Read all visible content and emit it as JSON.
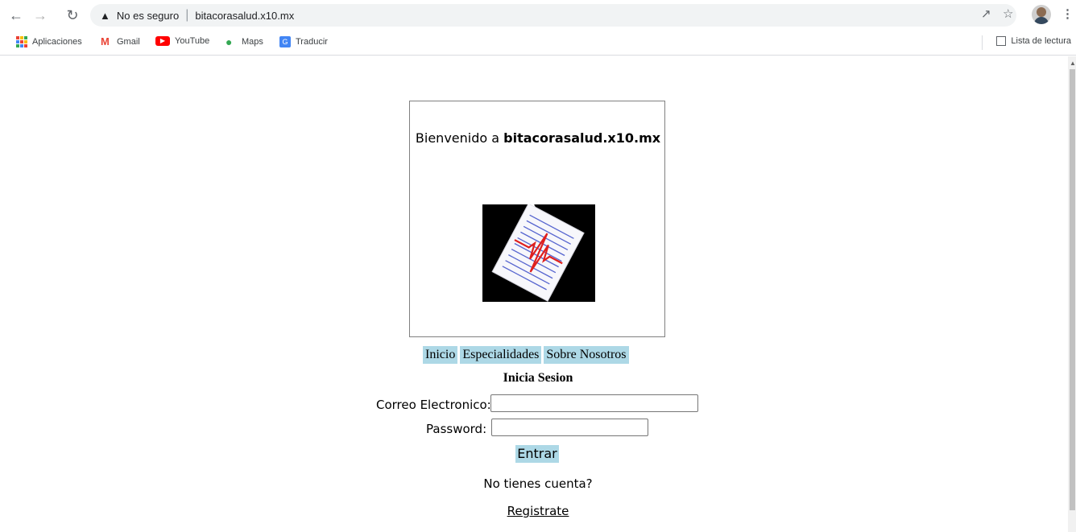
{
  "browser": {
    "security_warning": "No es seguro",
    "url": "bitacorasalud.x10.mx"
  },
  "bookmarks": {
    "items": [
      {
        "label": "Aplicaciones",
        "icon": "apps-icon"
      },
      {
        "label": "Gmail",
        "icon": "gmail-icon"
      },
      {
        "label": "YouTube",
        "icon": "youtube-icon"
      },
      {
        "label": "Maps",
        "icon": "maps-icon"
      },
      {
        "label": "Traducir",
        "icon": "translate-icon"
      }
    ],
    "reading_list": "Lista de lectura"
  },
  "card": {
    "welcome_prefix": "Bienvenido a ",
    "site_name": "bitacorasalud.x10.mx"
  },
  "menu": {
    "items": [
      "Inicio",
      "Especialidades",
      "Sobre Nosotros"
    ]
  },
  "login": {
    "title": "Inicia Sesion",
    "email_label": "Correo Electronico:",
    "email_value": "",
    "password_label": "Password:",
    "password_value": "",
    "submit_label": "Entrar",
    "no_account_text": "No tienes cuenta?",
    "register_link": "Registrate"
  },
  "colors": {
    "menu_background": "#add8e6",
    "card_border": "#808080"
  }
}
